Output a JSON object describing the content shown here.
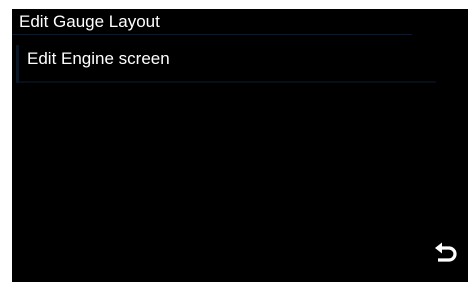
{
  "header": {
    "title": "Edit Gauge Layout"
  },
  "menu": {
    "items": [
      {
        "label": "Edit Engine screen"
      }
    ]
  },
  "footer": {
    "back_icon": "back-arrow-icon"
  },
  "colors": {
    "background": "#000000",
    "text": "#ffffff",
    "page_margin": "#ffffff"
  }
}
